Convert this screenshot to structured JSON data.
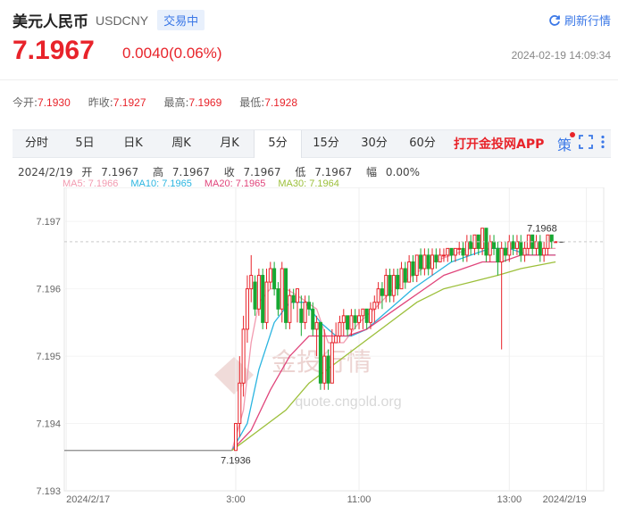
{
  "header": {
    "name": "美元人民币",
    "code": "USDCNY",
    "status": "交易中",
    "refresh_label": "刷新行情"
  },
  "quote": {
    "price": "7.1967",
    "change": "0.0040(0.06%)",
    "timestamp": "2024-02-19 14:09:34"
  },
  "stats": [
    {
      "label": "今开:",
      "value": "7.1930"
    },
    {
      "label": "昨收:",
      "value": "7.1927"
    },
    {
      "label": "最高:",
      "value": "7.1969"
    },
    {
      "label": "最低:",
      "value": "7.1928"
    }
  ],
  "tabs": [
    {
      "label": "分时",
      "active": false
    },
    {
      "label": "5日",
      "active": false
    },
    {
      "label": "日K",
      "active": false
    },
    {
      "label": "周K",
      "active": false
    },
    {
      "label": "月K",
      "active": false
    },
    {
      "label": "5分",
      "active": true
    },
    {
      "label": "15分",
      "active": false
    },
    {
      "label": "30分",
      "active": false
    },
    {
      "label": "60分",
      "active": false
    }
  ],
  "app_link": "打开金投网APP",
  "toolbar": {
    "strategy_label": "策",
    "fullscreen_icon": "fullscreen-icon",
    "more_icon": "more-vertical-icon"
  },
  "ohlc": {
    "date": "2024/2/19",
    "open_label": "开",
    "open": "7.1967",
    "high_label": "高",
    "high": "7.1967",
    "close_label": "收",
    "close": "7.1967",
    "low_label": "低",
    "low": "7.1967",
    "amp_label": "幅",
    "amp": "0.00%"
  },
  "ma": [
    {
      "label": "MA5: 7.1966",
      "color": "#f29bb0"
    },
    {
      "label": "MA10: 7.1965",
      "color": "#2bb5e0"
    },
    {
      "label": "MA20: 7.1965",
      "color": "#e0457b"
    },
    {
      "label": "MA30: 7.1964",
      "color": "#9cbf3a"
    }
  ],
  "watermark": {
    "brand": "金投行情",
    "url": "quote.cngold.org"
  },
  "chart_data": {
    "type": "candlestick",
    "yticks": [
      "7.197",
      "7.196",
      "7.195",
      "7.194",
      "7.193"
    ],
    "ytick_values": [
      7.197,
      7.196,
      7.195,
      7.194,
      7.193
    ],
    "ylim": [
      7.193,
      7.1974
    ],
    "xticks": [
      {
        "label": "2024/2/17",
        "index": 0
      },
      {
        "label": "3:00",
        "index": 44
      },
      {
        "label": "11:00",
        "index": 76
      },
      {
        "label": "13:00",
        "index": 115
      },
      {
        "label": "2024/2/19",
        "index": 135
      }
    ],
    "n": 140,
    "flat_until": 43,
    "flat_price": 7.1936,
    "candles": [
      [
        44,
        7.1936,
        7.194,
        7.194,
        7.1936
      ],
      [
        45,
        7.194,
        7.1946,
        7.195,
        7.1938
      ],
      [
        46,
        7.1946,
        7.1954,
        7.1956,
        7.1944
      ],
      [
        47,
        7.1954,
        7.196,
        7.1962,
        7.1952
      ],
      [
        48,
        7.196,
        7.1962,
        7.1965,
        7.1958
      ],
      [
        49,
        7.1961,
        7.1957,
        7.1962,
        7.1956
      ],
      [
        50,
        7.1957,
        7.1962,
        7.1963,
        7.1956
      ],
      [
        51,
        7.1962,
        7.1955,
        7.1963,
        7.1954
      ],
      [
        52,
        7.1955,
        7.1961,
        7.1963,
        7.1954
      ],
      [
        53,
        7.1961,
        7.1963,
        7.1964,
        7.196
      ],
      [
        54,
        7.1963,
        7.196,
        7.1964,
        7.1959
      ],
      [
        55,
        7.196,
        7.1957,
        7.1961,
        7.1956
      ],
      [
        56,
        7.1957,
        7.1963,
        7.1964,
        7.1955
      ],
      [
        57,
        7.1963,
        7.1955,
        7.1963,
        7.1954
      ],
      [
        58,
        7.1955,
        7.1959,
        7.196,
        7.1954
      ],
      [
        59,
        7.1959,
        7.1958,
        7.196,
        7.1957
      ],
      [
        60,
        7.1958,
        7.196,
        7.196,
        7.1955
      ],
      [
        61,
        7.1957,
        7.1955,
        7.1959,
        7.1953
      ],
      [
        62,
        7.1955,
        7.1958,
        7.1959,
        7.1954
      ],
      [
        63,
        7.1958,
        7.1957,
        7.1959,
        7.1956
      ],
      [
        64,
        7.1957,
        7.1954,
        7.1958,
        7.1953
      ],
      [
        65,
        7.1954,
        7.1955,
        7.1956,
        7.195
      ],
      [
        66,
        7.1955,
        7.1946,
        7.1955,
        7.1945
      ],
      [
        67,
        7.1946,
        7.195,
        7.1954,
        7.1945
      ],
      [
        68,
        7.195,
        7.1946,
        7.1951,
        7.1945
      ],
      [
        69,
        7.1946,
        7.1952,
        7.1954,
        7.1946
      ],
      [
        70,
        7.1952,
        7.1953,
        7.1955,
        7.1952
      ],
      [
        71,
        7.1953,
        7.1955,
        7.1956,
        7.1952
      ],
      [
        72,
        7.1955,
        7.1956,
        7.1957,
        7.1953
      ],
      [
        73,
        7.1956,
        7.1954,
        7.1956,
        7.1953
      ],
      [
        74,
        7.1954,
        7.1956,
        7.1957,
        7.1953
      ],
      [
        75,
        7.1956,
        7.1955,
        7.1957,
        7.1954
      ],
      [
        76,
        7.1955,
        7.1956,
        7.1957,
        7.1954
      ],
      [
        77,
        7.1956,
        7.1957,
        7.1957,
        7.1954
      ],
      [
        78,
        7.1957,
        7.1955,
        7.1957,
        7.1954
      ],
      [
        79,
        7.1955,
        7.1957,
        7.1958,
        7.1954
      ],
      [
        80,
        7.1957,
        7.1958,
        7.1959,
        7.1955
      ],
      [
        81,
        7.1958,
        7.196,
        7.1961,
        7.1957
      ],
      [
        82,
        7.196,
        7.1959,
        7.1961,
        7.1957
      ],
      [
        83,
        7.1959,
        7.1962,
        7.1963,
        7.1958
      ],
      [
        84,
        7.1962,
        7.1959,
        7.1963,
        7.1958
      ],
      [
        85,
        7.1959,
        7.1962,
        7.1963,
        7.1958
      ],
      [
        86,
        7.1962,
        7.196,
        7.1963,
        7.1959
      ],
      [
        87,
        7.196,
        7.1963,
        7.1964,
        7.196
      ],
      [
        88,
        7.1963,
        7.1961,
        7.1964,
        7.196
      ],
      [
        89,
        7.1961,
        7.1964,
        7.1965,
        7.1961
      ],
      [
        90,
        7.1964,
        7.1962,
        7.1965,
        7.1961
      ],
      [
        91,
        7.1962,
        7.1965,
        7.1965,
        7.1961
      ],
      [
        92,
        7.1965,
        7.1963,
        7.1966,
        7.1962
      ],
      [
        93,
        7.1963,
        7.1965,
        7.1966,
        7.1962
      ],
      [
        94,
        7.1965,
        7.1963,
        7.1966,
        7.1962
      ],
      [
        95,
        7.1963,
        7.1965,
        7.1966,
        7.1962
      ],
      [
        96,
        7.1965,
        7.1964,
        7.1966,
        7.1963
      ],
      [
        97,
        7.1964,
        7.1965,
        7.1966,
        7.1964
      ],
      [
        98,
        7.1965,
        7.1965,
        7.1966,
        7.1964
      ],
      [
        99,
        7.1965,
        7.1966,
        7.1966,
        7.1964
      ],
      [
        100,
        7.1966,
        7.1965,
        7.1966,
        7.1964
      ],
      [
        101,
        7.1965,
        7.1966,
        7.1966,
        7.1964
      ],
      [
        102,
        7.1966,
        7.1966,
        7.1967,
        7.1965
      ],
      [
        103,
        7.1966,
        7.1965,
        7.1967,
        7.1964
      ],
      [
        104,
        7.1965,
        7.1967,
        7.1968,
        7.1964
      ],
      [
        105,
        7.1967,
        7.1966,
        7.1968,
        7.1965
      ],
      [
        106,
        7.1966,
        7.1968,
        7.1968,
        7.1965
      ],
      [
        107,
        7.1968,
        7.1966,
        7.1968,
        7.1965
      ],
      [
        108,
        7.1966,
        7.1969,
        7.1969,
        7.1965
      ],
      [
        109,
        7.1969,
        7.1965,
        7.1969,
        7.1964
      ],
      [
        110,
        7.1965,
        7.1967,
        7.1968,
        7.1964
      ],
      [
        111,
        7.1967,
        7.1966,
        7.1968,
        7.1965
      ],
      [
        112,
        7.1966,
        7.1964,
        7.1967,
        7.1962
      ],
      [
        113,
        7.1964,
        7.1966,
        7.1967,
        7.1951
      ],
      [
        114,
        7.1966,
        7.1965,
        7.1967,
        7.1964
      ],
      [
        115,
        7.1965,
        7.1967,
        7.1968,
        7.1964
      ],
      [
        116,
        7.1967,
        7.1966,
        7.1968,
        7.1965
      ],
      [
        117,
        7.1966,
        7.1967,
        7.1968,
        7.1965
      ],
      [
        118,
        7.1967,
        7.1965,
        7.1968,
        7.1964
      ],
      [
        119,
        7.1965,
        7.1966,
        7.1967,
        7.1964
      ],
      [
        120,
        7.1966,
        7.1968,
        7.1968,
        7.1965
      ],
      [
        121,
        7.1968,
        7.1966,
        7.1968,
        7.1965
      ],
      [
        122,
        7.1966,
        7.1967,
        7.1968,
        7.1965
      ],
      [
        123,
        7.1967,
        7.1965,
        7.1968,
        7.1964
      ],
      [
        124,
        7.1965,
        7.1966,
        7.1967,
        7.1964
      ],
      [
        125,
        7.1966,
        7.1968,
        7.1968,
        7.1965
      ],
      [
        126,
        7.1968,
        7.1967,
        7.1968,
        7.1966
      ],
      [
        127,
        7.1967,
        7.1967,
        7.1967,
        7.1967
      ]
    ],
    "ma_series": {
      "ma5": [
        [
          43,
          7.1936
        ],
        [
          46,
          7.1942
        ],
        [
          48,
          7.1952
        ],
        [
          50,
          7.1958
        ],
        [
          53,
          7.196
        ],
        [
          57,
          7.196
        ],
        [
          60,
          7.1959
        ],
        [
          65,
          7.1957
        ],
        [
          68,
          7.1952
        ],
        [
          72,
          7.1952
        ],
        [
          76,
          7.1955
        ],
        [
          80,
          7.1957
        ],
        [
          85,
          7.196
        ],
        [
          90,
          7.1962
        ],
        [
          95,
          7.1964
        ],
        [
          100,
          7.1965
        ],
        [
          105,
          7.1966
        ],
        [
          110,
          7.1966
        ],
        [
          115,
          7.1966
        ],
        [
          120,
          7.1966
        ],
        [
          127,
          7.1966
        ]
      ],
      "ma10": [
        [
          43,
          7.1936
        ],
        [
          47,
          7.194
        ],
        [
          50,
          7.1948
        ],
        [
          54,
          7.1955
        ],
        [
          58,
          7.1958
        ],
        [
          62,
          7.1958
        ],
        [
          66,
          7.1955
        ],
        [
          70,
          7.1953
        ],
        [
          74,
          7.1953
        ],
        [
          78,
          7.1954
        ],
        [
          82,
          7.1956
        ],
        [
          86,
          7.1958
        ],
        [
          90,
          7.196
        ],
        [
          95,
          7.1962
        ],
        [
          100,
          7.1964
        ],
        [
          105,
          7.1965
        ],
        [
          110,
          7.1966
        ],
        [
          115,
          7.1966
        ],
        [
          120,
          7.1965
        ],
        [
          127,
          7.1965
        ]
      ],
      "ma20": [
        [
          43,
          7.1936
        ],
        [
          48,
          7.1939
        ],
        [
          53,
          7.1945
        ],
        [
          58,
          7.195
        ],
        [
          63,
          7.1953
        ],
        [
          68,
          7.1953
        ],
        [
          73,
          7.1953
        ],
        [
          78,
          7.1954
        ],
        [
          83,
          7.1956
        ],
        [
          88,
          7.1958
        ],
        [
          93,
          7.196
        ],
        [
          98,
          7.1962
        ],
        [
          103,
          7.1963
        ],
        [
          108,
          7.1964
        ],
        [
          113,
          7.1964
        ],
        [
          118,
          7.1965
        ],
        [
          127,
          7.1965
        ]
      ],
      "ma30": [
        [
          43,
          7.1936
        ],
        [
          50,
          7.1939
        ],
        [
          57,
          7.1942
        ],
        [
          63,
          7.1946
        ],
        [
          70,
          7.1949
        ],
        [
          77,
          7.1952
        ],
        [
          84,
          7.1955
        ],
        [
          91,
          7.1958
        ],
        [
          98,
          7.196
        ],
        [
          105,
          7.1961
        ],
        [
          112,
          7.1962
        ],
        [
          118,
          7.1963
        ],
        [
          127,
          7.1964
        ]
      ]
    },
    "annotations": [
      {
        "label": "7.1968",
        "index": 126,
        "value": 7.1968
      },
      {
        "label": "7.1936",
        "index": 44,
        "value": 7.1936
      }
    ]
  }
}
